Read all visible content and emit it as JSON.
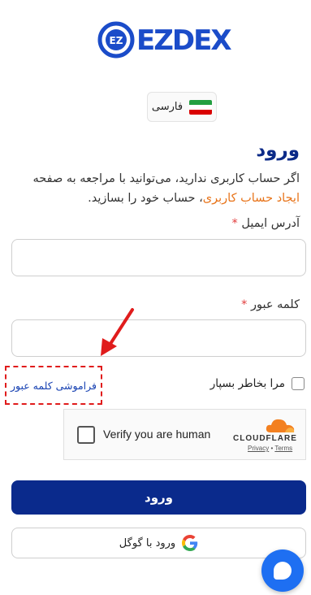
{
  "brand": {
    "logo_text": "EZDEX",
    "logo_mark": "EZ"
  },
  "language": {
    "label": "فارسی",
    "flag_colors": [
      "#239f40",
      "#ffffff",
      "#da0000"
    ]
  },
  "login": {
    "title": "ورود",
    "description_prefix": "اگر حساب کاربری ندارید، می‌توانید با مراجعه به صفحه",
    "register_link": "ایجاد حساب کاربری",
    "description_suffix": "، حساب خود را بسازید."
  },
  "email": {
    "label": "آدرس ایمیل",
    "required_mark": "*",
    "value": ""
  },
  "password": {
    "label": "کلمه عبور",
    "required_mark": "*",
    "value": ""
  },
  "remember_me": {
    "label": "مرا بخاطر بسپار",
    "checked": false
  },
  "forgot_password": {
    "label": "فراموشی کلمه عبور"
  },
  "captcha": {
    "label": "Verify you are human",
    "brand": "CLOUDFLARE",
    "privacy": "Privacy",
    "separator": "•",
    "terms": "Terms"
  },
  "buttons": {
    "login": "ورود",
    "google": "ورود با گوگل"
  },
  "colors": {
    "primary": "#0a2a8c",
    "accent": "#e8741a",
    "required": "#e23b3b",
    "annotation": "#e01c1c"
  }
}
